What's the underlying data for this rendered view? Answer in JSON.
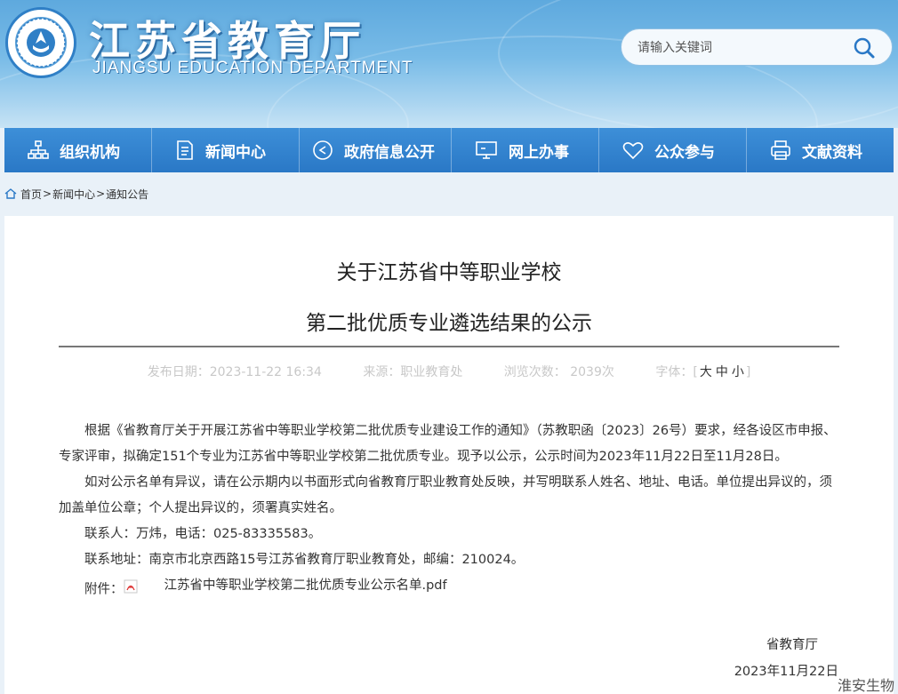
{
  "header": {
    "title": "江苏省教育厅",
    "subtitle": "JIANGSU EDUCATION DEPARTMENT",
    "search_placeholder": "请输入关键词"
  },
  "nav": {
    "items": [
      {
        "label": "组织机构",
        "icon": "org-chart-icon"
      },
      {
        "label": "新闻中心",
        "icon": "document-icon"
      },
      {
        "label": "政府信息公开",
        "icon": "play-circle-icon"
      },
      {
        "label": "网上办事",
        "icon": "monitor-icon"
      },
      {
        "label": "公众参与",
        "icon": "heart-icon"
      },
      {
        "label": "文献资料",
        "icon": "printer-icon"
      }
    ]
  },
  "breadcrumb": {
    "home": "首页",
    "sep1": ">",
    "news": "新闻中心",
    "sep2": ">",
    "notice": "通知公告"
  },
  "article": {
    "title_line1": "关于江苏省中等职业学校",
    "title_line2": "第二批优质专业遴选结果的公示",
    "meta": {
      "date": "发布日期：2023-11-22 16:34",
      "source": "来源：职业教育处",
      "views": "浏览次数： 2039次",
      "font_label": "字体：",
      "bracket_open": "[",
      "font_large": "大",
      "font_medium": "中",
      "font_small": "小",
      "bracket_close": "]"
    },
    "paragraphs": [
      "根据《省教育厅关于开展江苏省中等职业学校第二批优质专业建设工作的通知》（苏教职函〔2023〕26号）要求，经各设区市申报、专家评审，拟确定151个专业为江苏省中等职业学校第二批优质专业。现予以公示，公示时间为2023年11月22日至11月28日。",
      "如对公示名单有异议，请在公示期内以书面形式向省教育厅职业教育处反映，并写明联系人姓名、地址、电话。单位提出异议的，须加盖单位公章；个人提出异议的，须署真实姓名。",
      "联系人：万炜，电话：025-83335583。",
      "联系地址：南京市北京西路15号江苏省教育厅职业教育处，邮编：210024。"
    ],
    "attachment_label": "附件：",
    "attachment_name": "江苏省中等职业学校第二批优质专业公示名单.pdf",
    "signature_org": "省教育厅",
    "signature_date": "2023年11月22日"
  },
  "watermark": "淮安生物",
  "colors": {
    "nav_bg": "#2a78c6",
    "header_bg": "#78bbe7",
    "page_bg": "#e9f1f8"
  }
}
